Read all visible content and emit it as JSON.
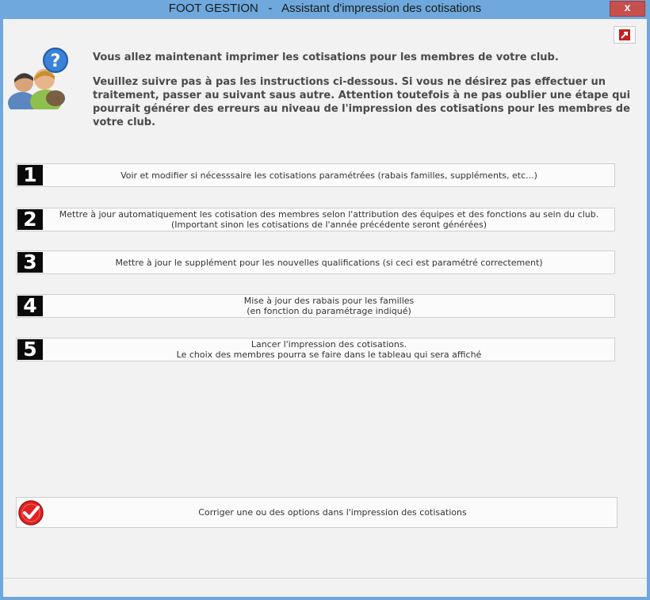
{
  "window": {
    "title": "FOOT GESTION   -   Assistant d'impression des cotisations",
    "close_label": "x"
  },
  "intro": {
    "line1": "Vous allez maintenant imprimer les cotisations pour les membres de votre club.",
    "line2": "Veuillez suivre pas à pas les instructions ci-dessous. Si vous ne désirez pas effectuer un traitement, passer au suivant saus autre. Attention toutefois à ne pas oublier une étape qui pourrait générer des erreurs au niveau de l'impression des cotisations pour les membres de votre club."
  },
  "steps": [
    {
      "number": "1",
      "line1": "Voir et modifier si nécesssaire les cotisations paramétrées (rabais familles, suppléments, etc...)",
      "line2": ""
    },
    {
      "number": "2",
      "line1": "Mettre à jour automatiquement les cotisation des membres selon l'attribution des équipes et des fonctions au sein du club.",
      "line2": "(Important sinon les cotisations de l'année précédente seront générées)"
    },
    {
      "number": "3",
      "line1": "Mettre à jour le supplément pour les nouvelles qualifications (si ceci est paramétré correctement)",
      "line2": ""
    },
    {
      "number": "4",
      "line1": "Mise à jour des rabais pour les familles",
      "line2": "(en fonction du paramétrage indiqué)"
    },
    {
      "number": "5",
      "line1": "Lancer l'impression des cotisations.",
      "line2": "Le choix des membres pourra se faire dans le tableau qui sera affiché"
    }
  ],
  "correct_button": {
    "label": "Corriger une ou des options dans l'impression des cotisations",
    "icon": "checkmark-icon"
  },
  "icons": {
    "users": "users-help-icon",
    "popout": "popout-arrow-icon"
  },
  "colors": {
    "titlebar": "#6ea8dc",
    "close": "#c7504f",
    "number_bg": "#0a0a0a",
    "check": "#e0211f"
  }
}
